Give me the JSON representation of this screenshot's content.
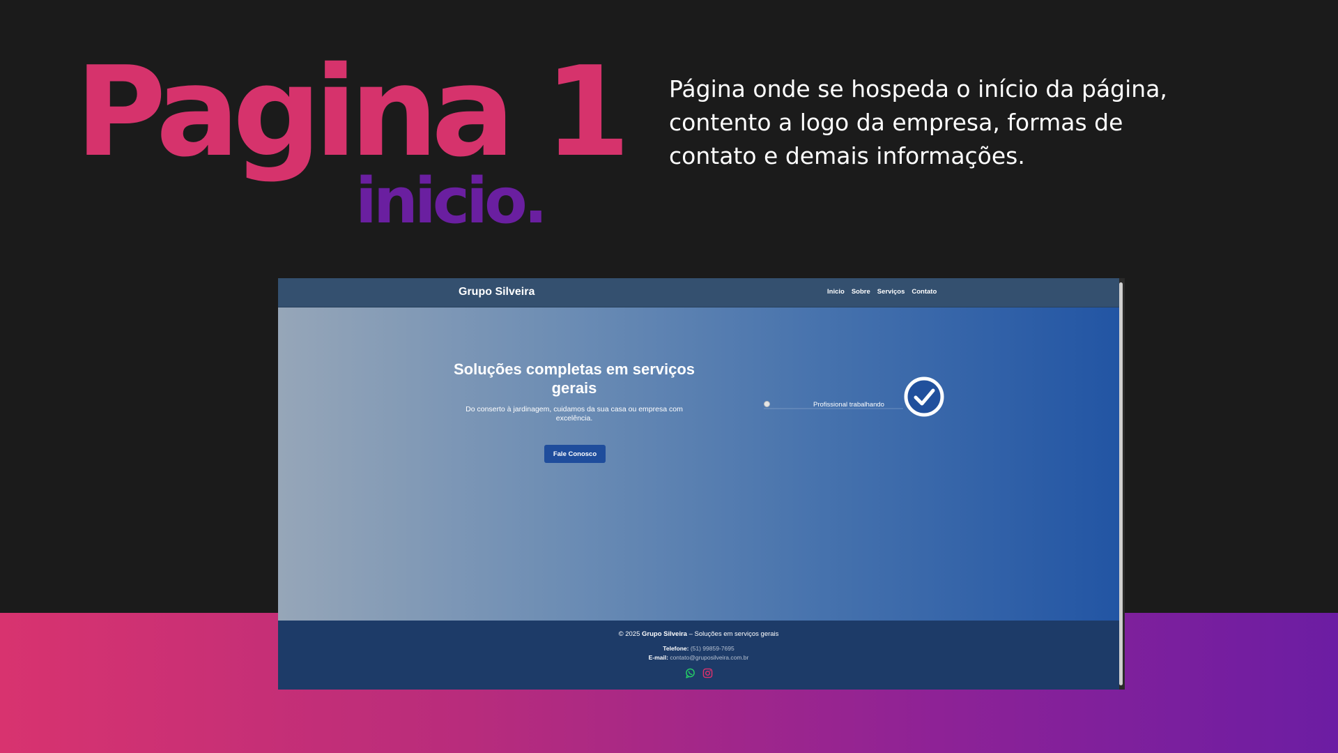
{
  "slide": {
    "headline": "Pagina 1",
    "subheadline": "inicio.",
    "description": "Página onde se hospeda o início da página, contento a logo da empresa, formas de contato e demais informações."
  },
  "colors": {
    "headline": "#d6336c",
    "subheadline": "#6a1fa0",
    "background": "#1b1b1b",
    "band_start": "#d8336f",
    "band_end": "#6c1da3",
    "header": "#34506f",
    "footer": "#1d3b68",
    "cta": "#1f4d9c"
  },
  "site": {
    "brand": "Grupo Silveira",
    "nav": [
      {
        "label": "Inicio"
      },
      {
        "label": "Sobre"
      },
      {
        "label": "Serviços"
      },
      {
        "label": "Contato"
      }
    ],
    "hero": {
      "title": "Soluções completas em serviços gerais",
      "text": "Do conserto à jardinagem, cuidamos da sua casa ou empresa com excelência.",
      "cta": "Fale Conosco",
      "image_alt": "Profissional trabalhando",
      "badge_icon": "check-circle-icon"
    },
    "footer": {
      "copyright_prefix": "© 2025 ",
      "copyright_brand": "Grupo Silveira",
      "copyright_suffix": " – Soluções em serviços gerais",
      "phone_label": "Telefone:",
      "phone_value": "(51) 99859-7695",
      "email_label": "E-mail:",
      "email_value": "contato@gruposilveira.com.br",
      "social_icons": [
        "whatsapp-icon",
        "instagram-icon"
      ]
    }
  }
}
